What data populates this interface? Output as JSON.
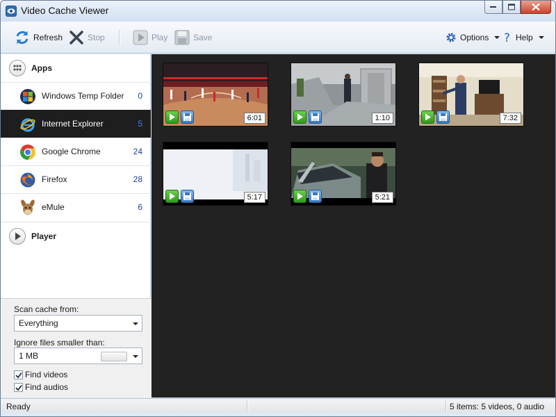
{
  "window": {
    "title": "Video Cache Viewer"
  },
  "toolbar": {
    "refresh": "Refresh",
    "stop": "Stop",
    "play": "Play",
    "save": "Save",
    "options": "Options",
    "help": "Help"
  },
  "sidebar": {
    "apps_header": "Apps",
    "player_header": "Player",
    "items": [
      {
        "label": "Windows Temp Folder",
        "count": "0",
        "icon": "windows-icon"
      },
      {
        "label": "Internet Explorer",
        "count": "5",
        "icon": "internet-explorer-icon"
      },
      {
        "label": "Google Chrome",
        "count": "24",
        "icon": "chrome-icon"
      },
      {
        "label": "Firefox",
        "count": "28",
        "icon": "firefox-icon"
      },
      {
        "label": "eMule",
        "count": "6",
        "icon": "emule-icon"
      }
    ],
    "selected_index": 1
  },
  "filters": {
    "scan_label": "Scan cache from:",
    "scan_value": "Everything",
    "ignore_label": "Ignore files smaller than:",
    "ignore_value": "1 MB",
    "find_videos": "Find videos",
    "find_audios": "Find audios"
  },
  "videos": [
    {
      "duration": "6:01",
      "scene": "basketball-court"
    },
    {
      "duration": "1:10",
      "scene": "office-hallway"
    },
    {
      "duration": "7:32",
      "scene": "living-room"
    },
    {
      "duration": "5:17",
      "scene": "bright-sky"
    },
    {
      "duration": "5:21",
      "scene": "convertible-car"
    }
  ],
  "status": {
    "left": "Ready",
    "right": "5 items: 5 videos, 0 audio"
  },
  "colors": {
    "content_bg": "#222222",
    "selected_item_bg": "#1e1e1e",
    "count_blue": "#1f3f9a"
  }
}
